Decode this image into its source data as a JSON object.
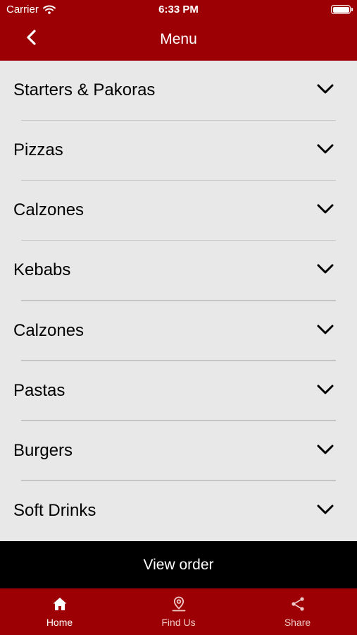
{
  "status_bar": {
    "carrier": "Carrier",
    "time": "6:33 PM"
  },
  "header": {
    "title": "Menu"
  },
  "menu": {
    "categories": [
      {
        "label": "Starters & Pakoras"
      },
      {
        "label": "Pizzas"
      },
      {
        "label": "Calzones"
      },
      {
        "label": "Kebabs"
      },
      {
        "label": "Calzones"
      },
      {
        "label": "Pastas"
      },
      {
        "label": "Burgers"
      },
      {
        "label": "Soft Drinks"
      }
    ]
  },
  "view_order": {
    "label": "View order"
  },
  "tabs": [
    {
      "label": "Home",
      "icon": "home-icon",
      "active": true
    },
    {
      "label": "Find Us",
      "icon": "location-pin-icon",
      "active": false
    },
    {
      "label": "Share",
      "icon": "share-icon",
      "active": false
    }
  ],
  "colors": {
    "brand": "#9c0005",
    "list_bg": "#e8e8e8",
    "bar": "#000000"
  }
}
